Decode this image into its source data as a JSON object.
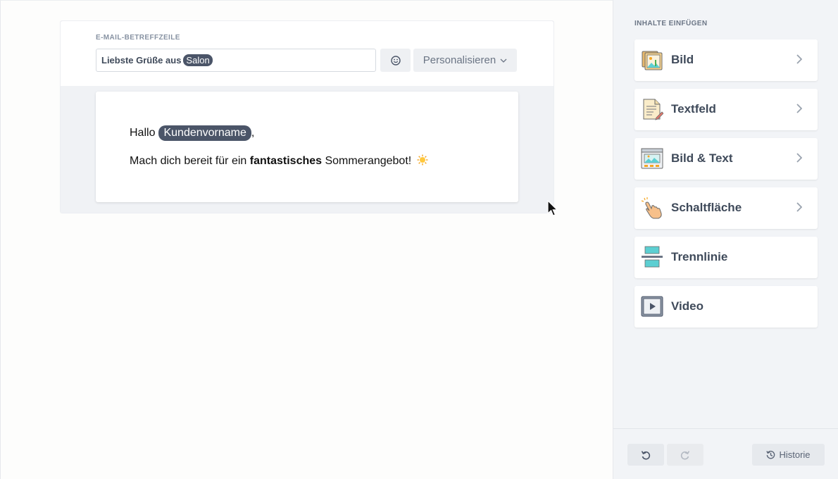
{
  "editor": {
    "subject_label": "E-MAIL-BETREFFZEILE",
    "subject_text": "Liebste Grüße aus",
    "subject_tag": "Salon",
    "personalize_label": "Personalisieren",
    "greeting_prefix": "Hallo",
    "greeting_tag": "Kundenvorname",
    "greeting_suffix": ",",
    "line2_before": "Mach dich bereit für ein",
    "line2_bold": "fantastisches",
    "line2_after": "Sommerangebot!"
  },
  "sidebar": {
    "title": "INHALTE EINFÜGEN",
    "blocks": [
      {
        "label": "Bild",
        "icon": "image-icon",
        "has_chevron": true
      },
      {
        "label": "Textfeld",
        "icon": "text-field-icon",
        "has_chevron": true
      },
      {
        "label": "Bild & Text",
        "icon": "image-text-icon",
        "has_chevron": true
      },
      {
        "label": "Schaltfläche",
        "icon": "button-hand-icon",
        "has_chevron": true
      },
      {
        "label": "Trennlinie",
        "icon": "divider-icon",
        "has_chevron": false
      },
      {
        "label": "Video",
        "icon": "video-icon",
        "has_chevron": false
      }
    ],
    "history_label": "Historie"
  },
  "colors": {
    "tag_bg": "#4b5568",
    "accent_teal": "#5ccfd2",
    "text_dark": "#3f4a5a"
  }
}
